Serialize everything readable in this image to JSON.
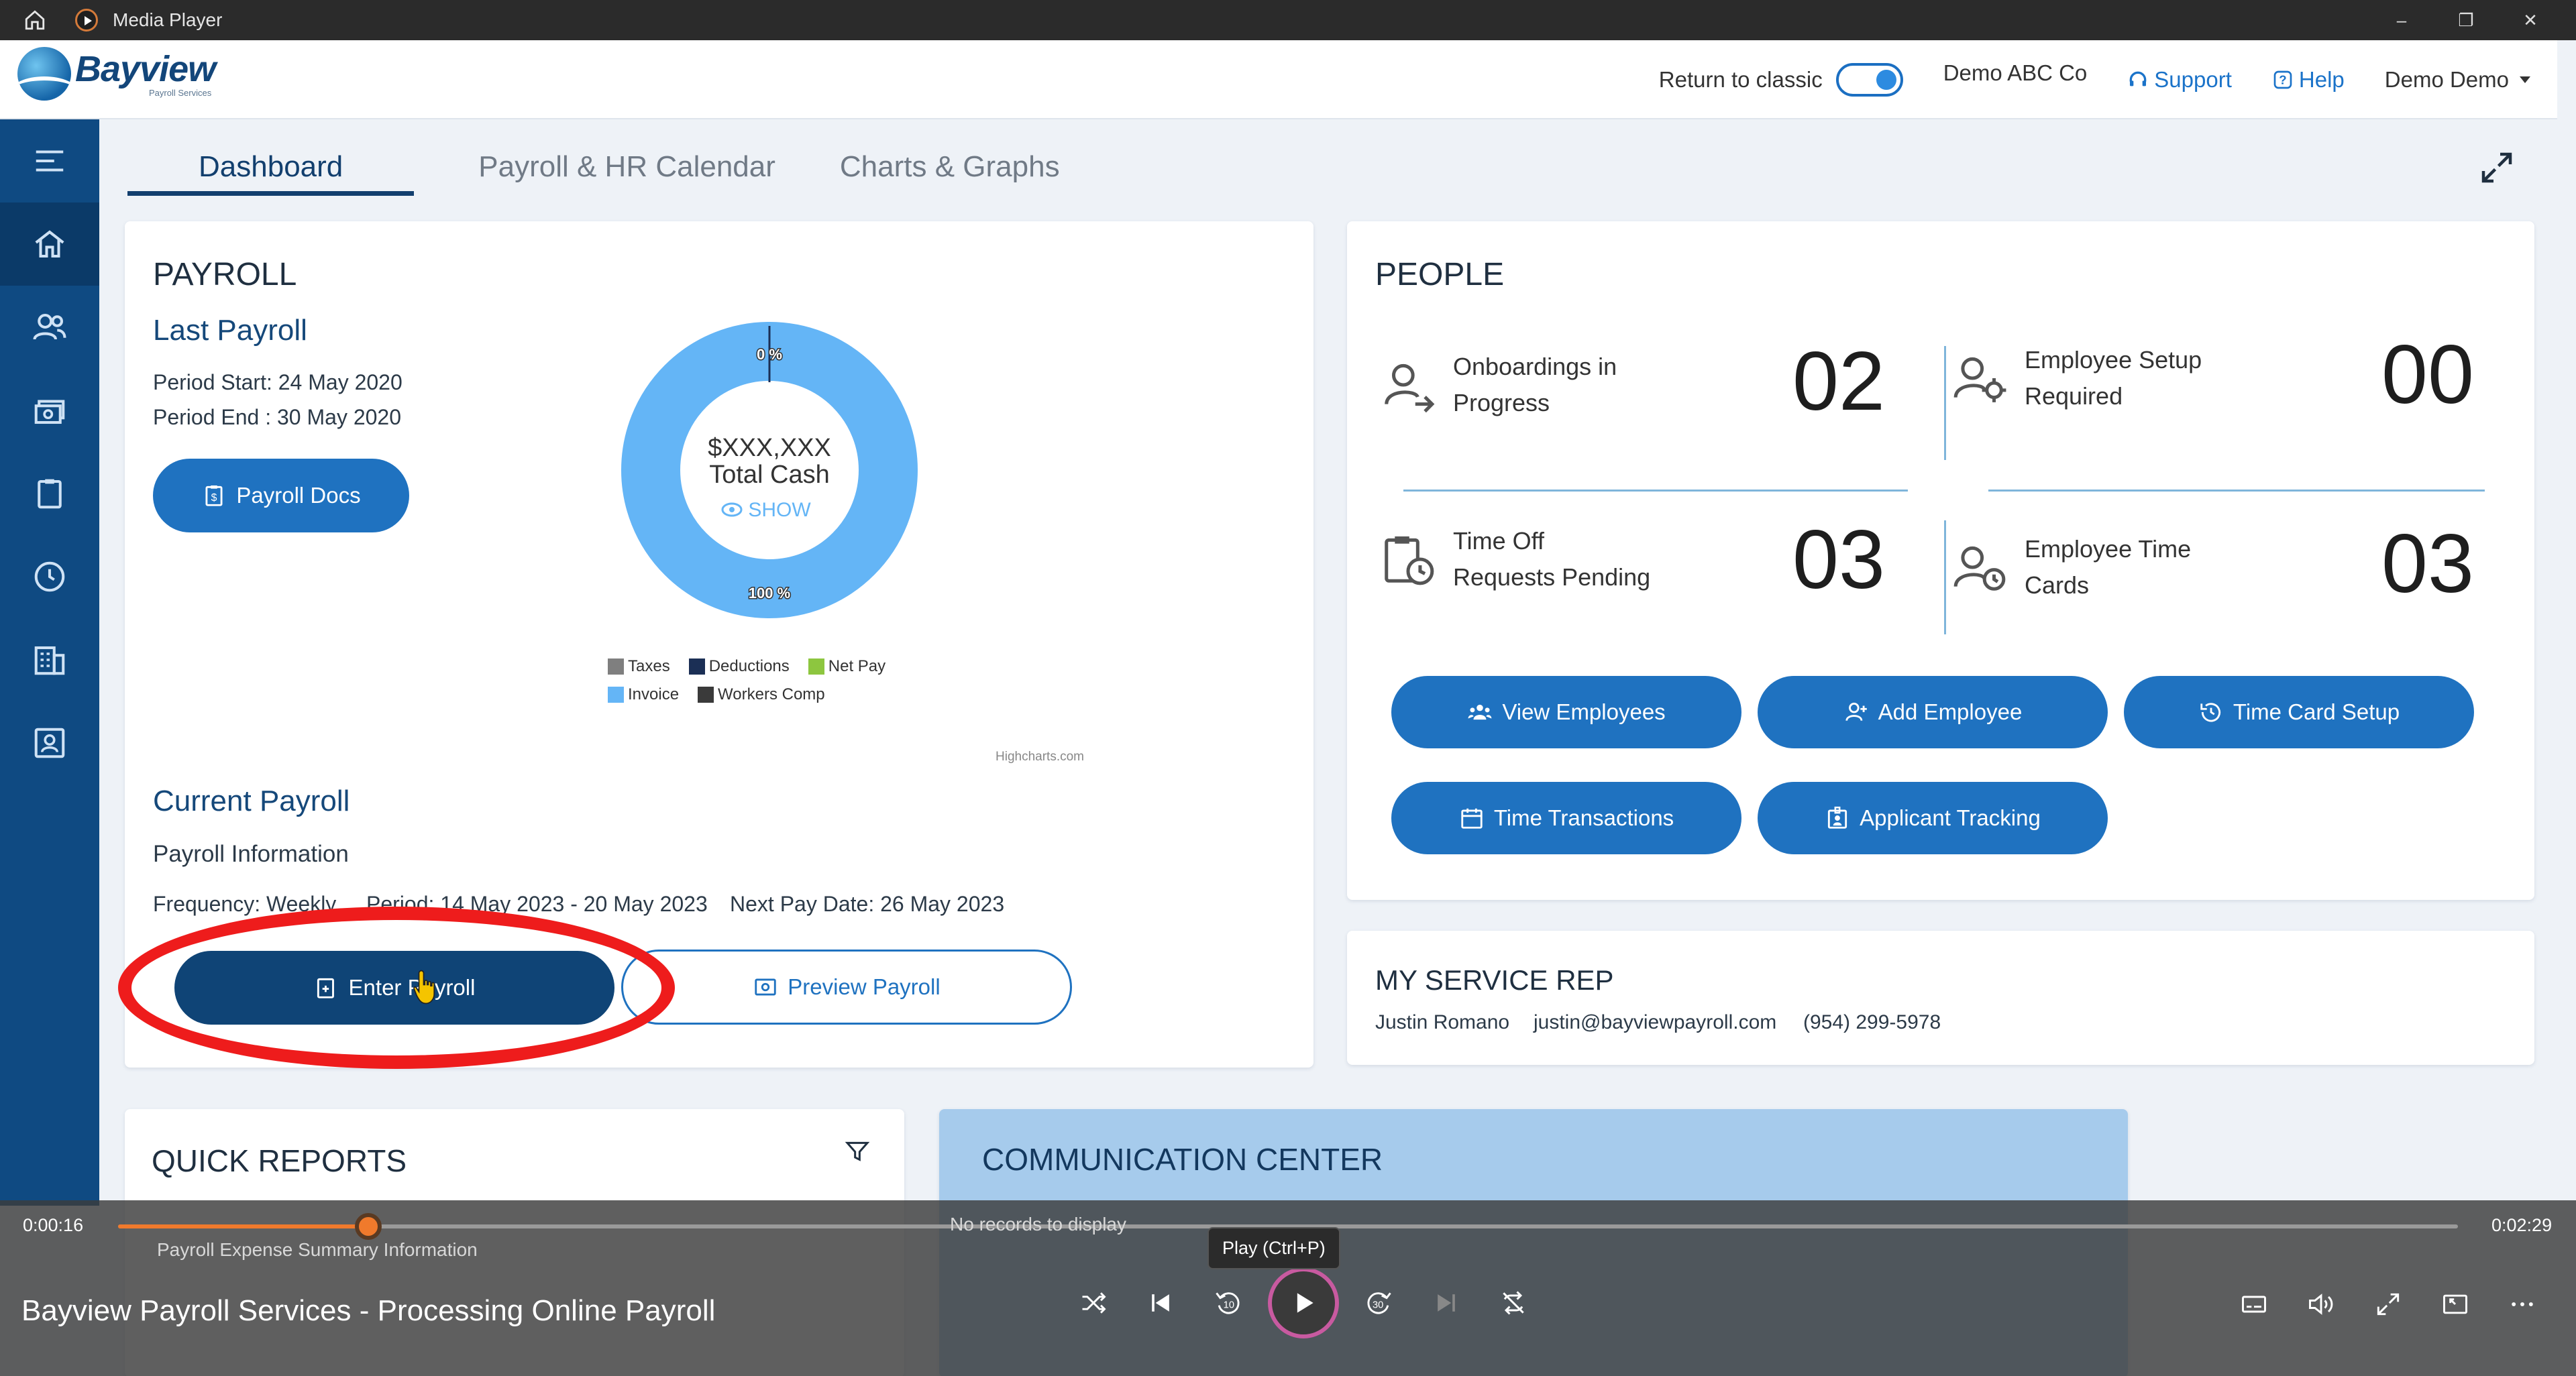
{
  "window": {
    "title": "Media Player",
    "ctrl_min": "–",
    "ctrl_max": "❐",
    "ctrl_close": "✕"
  },
  "header": {
    "brand": "Bayview",
    "brand_sub": "Payroll Services",
    "return_classic": "Return to classic",
    "company": "Demo ABC Co",
    "support": "Support",
    "help": "Help",
    "user": "Demo Demo"
  },
  "tabs": [
    "Dashboard",
    "Payroll & HR Calendar",
    "Charts & Graphs"
  ],
  "payroll": {
    "title": "PAYROLL",
    "last_title": "Last Payroll",
    "period_start": "Period Start: 24 May 2020",
    "period_end": "Period End : 30 May 2020",
    "docs_btn": "Payroll Docs",
    "donut_amount": "$XXX,XXX",
    "donut_label": "Total Cash",
    "donut_show": "SHOW",
    "label_top": "0 %",
    "label_bottom": "100 %",
    "credits": "Highcharts.com",
    "current_title": "Current Payroll",
    "info_title": "Payroll Information",
    "frequency": "Frequency: Weekly",
    "period": "Period: 14 May 2023 - 20 May 2023",
    "next_pay": "Next Pay Date: 26 May 2023",
    "enter_btn": "Enter Payroll",
    "preview_btn": "Preview Payroll"
  },
  "chart_data": {
    "type": "pie",
    "categories": [
      "Taxes",
      "Deductions",
      "Net Pay",
      "Invoice",
      "Workers Comp"
    ],
    "values": [
      0,
      0,
      0,
      100,
      0
    ],
    "colors": [
      "#7f7f7f",
      "#1b2f55",
      "#8dc63f",
      "#64b5f6",
      "#3a3a3a"
    ],
    "legend": "bottom"
  },
  "people": {
    "title": "PEOPLE",
    "metrics": [
      {
        "label1": "Onboardings in",
        "label2": "Progress",
        "value": "02"
      },
      {
        "label1": "Employee Setup",
        "label2": "Required",
        "value": "00"
      },
      {
        "label1": "Time Off",
        "label2": "Requests Pending",
        "value": "03"
      },
      {
        "label1": "Employee Time",
        "label2": "Cards",
        "value": "03"
      }
    ],
    "buttons": [
      "View Employees",
      "Add Employee",
      "Time Card Setup",
      "Time Transactions",
      "Applicant Tracking"
    ]
  },
  "rep": {
    "title": "MY SERVICE REP",
    "name": "Justin Romano",
    "email": "justin@bayviewpayroll.com",
    "phone": "(954) 299-5978"
  },
  "quick_reports": {
    "title": "QUICK REPORTS",
    "item": "Payroll Expense Summary Information"
  },
  "comm_center": {
    "title": "COMMUNICATION CENTER",
    "empty": "No records to display"
  },
  "player": {
    "elapsed": "0:00:16",
    "total": "0:02:29",
    "progress": 0.107,
    "video_title": "Bayview Payroll Services - Processing Online Payroll",
    "tooltip": "Play (Ctrl+P)",
    "accent": "#f07a2c"
  }
}
